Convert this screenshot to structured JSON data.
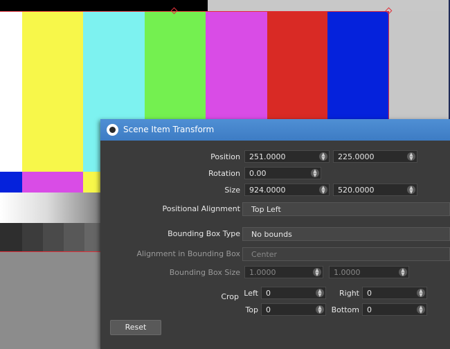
{
  "dialog": {
    "title": "Scene Item Transform",
    "labels": {
      "position": "Position",
      "rotation": "Rotation",
      "size": "Size",
      "positional_alignment": "Positional Alignment",
      "bounding_box_type": "Bounding Box Type",
      "alignment_in_bounding_box": "Alignment in Bounding Box",
      "bounding_box_size": "Bounding Box Size",
      "crop": "Crop",
      "crop_left": "Left",
      "crop_right": "Right",
      "crop_top": "Top",
      "crop_bottom": "Bottom"
    },
    "values": {
      "position_x": "251.0000",
      "position_y": "225.0000",
      "rotation": "0.00",
      "size_w": "924.0000",
      "size_h": "520.0000",
      "positional_alignment": "Top Left",
      "bounding_box_type": "No bounds",
      "alignment_in_bounding_box": "Center",
      "bounding_box_w": "1.0000",
      "bounding_box_h": "1.0000",
      "crop_left": "0",
      "crop_right": "0",
      "crop_top": "0",
      "crop_bottom": "0"
    },
    "reset_label": "Reset"
  },
  "icons": {
    "app": "obs-logo-icon",
    "spin": "spinner-arrows-icon"
  },
  "colors": {
    "titlebar": "#4a89d0",
    "selection": "#e2303a",
    "color_bars": [
      "#ffffff",
      "#f7f74a",
      "#7df2f0",
      "#74f050",
      "#d94ce6",
      "#d92a25",
      "#0522dc"
    ]
  }
}
